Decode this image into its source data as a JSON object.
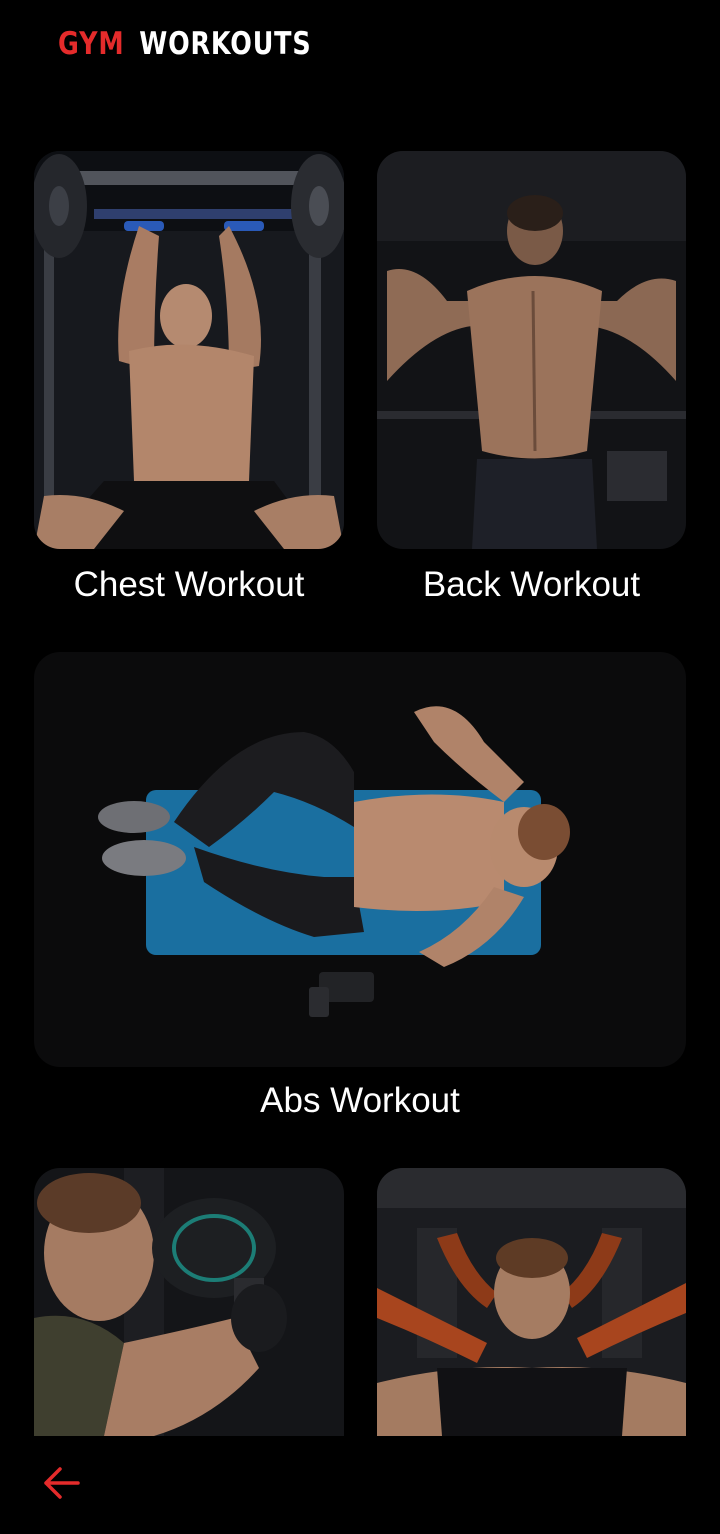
{
  "header": {
    "title_accent": "GYM",
    "title_main": "WORKOUTS"
  },
  "colors": {
    "background": "#000000",
    "accent": "#e52b2b",
    "text": "#ffffff"
  },
  "workouts": [
    {
      "label": "Chest Workout",
      "image": "chest-workout-photo"
    },
    {
      "label": "Back Workout",
      "image": "back-workout-photo"
    },
    {
      "label": "Abs Workout",
      "image": "abs-workout-photo"
    },
    {
      "label": "",
      "image": "biceps-workout-photo"
    },
    {
      "label": "",
      "image": "shoulder-workout-photo"
    }
  ],
  "navigation": {
    "back_icon": "arrow-left-icon"
  }
}
